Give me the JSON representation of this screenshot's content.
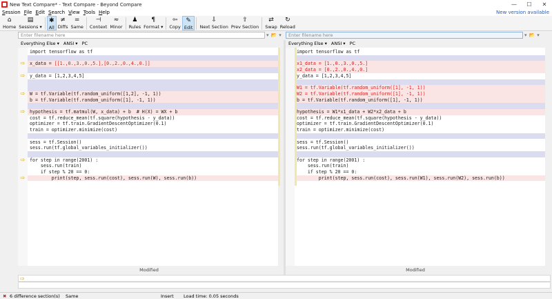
{
  "window": {
    "title": "New Text Compare* - Text Compare - Beyond Compare",
    "minimize": "—",
    "maximize": "☐",
    "close": "✕"
  },
  "menu": {
    "items": [
      "Session",
      "File",
      "Edit",
      "Search",
      "View",
      "Tools",
      "Help"
    ],
    "new_version": "New version available"
  },
  "toolbar": {
    "buttons": [
      {
        "icon": "⌂",
        "label": "Home"
      },
      {
        "icon": "▤",
        "label": "Sessions ▾"
      },
      {
        "icon": "✱",
        "label": "All"
      },
      {
        "icon": "≠",
        "label": "Diffs"
      },
      {
        "icon": "=",
        "label": "Same"
      },
      {
        "icon": "⊣",
        "label": "Context"
      },
      {
        "icon": "≈",
        "label": "Minor"
      },
      {
        "icon": "♟",
        "label": "Rules"
      },
      {
        "icon": "¶",
        "label": "Format ▾"
      },
      {
        "icon": "⇦",
        "label": "Copy"
      },
      {
        "icon": "✎",
        "label": "Edit"
      },
      {
        "icon": "⇩",
        "label": "Next Section"
      },
      {
        "icon": "⇧",
        "label": "Prev Section"
      },
      {
        "icon": "⇄",
        "label": "Swap"
      },
      {
        "icon": "↻",
        "label": "Reload"
      }
    ]
  },
  "left": {
    "path_placeholder": "Enter filename here",
    "format": "Everything Else ▾",
    "encoding": "ANSI ▾",
    "line_endings": "PC",
    "status": "Modified",
    "lines": [
      "import tensorflow as tf",
      "",
      "x_data = [[1.,0.,3.,0.,5.],[0.,2.,0.,4.,0.]]",
      "",
      "y_data = [1,2,3,4,5]",
      "",
      "",
      "W = tf.Variable(tf.random_uniform([1,2], -1, 1))",
      "b = tf.Variable(tf.random_uniform([1], -1, 1))",
      "",
      "hypothesis = tf.matmul(W, x_data) + b  # H(X) = WX + b",
      "cost = tf.reduce_mean(tf.square(hypothesis - y_data))",
      "optimizer = tf.train.GradientDescentOptimizer(0.1)",
      "train = optimizer.minimize(cost)",
      "",
      "sess = tf.Session()",
      "sess.run(tf.global_variables_initializer())",
      "",
      "for step in range(2001) :",
      "    sess.run(train)",
      "    if step % 20 == 0:",
      "        print(step, sess.run(cost), sess.run(W), sess.run(b))"
    ]
  },
  "right": {
    "path_placeholder": "Enter filename here",
    "format": "Everything Else ▾",
    "encoding": "ANSI ▾",
    "line_endings": "PC",
    "status": "Modified",
    "lines": [
      "import tensorflow as tf",
      "",
      "x1_data = [1.,0.,3.,0.,5.]",
      "x2_data = [0.,2.,0.,4.,0.]",
      "y_data = [1,2,3,4,5]",
      "",
      "W1 = tf.Variable(tf.random_uniform([1], -1, 1))",
      "W2 = tf.Variable(tf.random_uniform([1], -1, 1))",
      "b = tf.Variable(tf.random_uniform([1], -1, 1))",
      "",
      "hypothesis = W1*x1_data + W2*x2_data + b",
      "cost = tf.reduce_mean(tf.square(hypothesis - y_data))",
      "optimizer = tf.train.GradientDescentOptimizer(0.1)",
      "train = optimizer.minimize(cost)",
      "",
      "sess = tf.Session()",
      "sess.run(tf.global_variables_initializer())",
      "",
      "for step in range(2001) :",
      "    sess.run(train)",
      "    if step % 20 == 0:",
      "        print(step, sess.run(cost), sess.run(W1), sess.run(W2), sess.run(b))"
    ]
  },
  "statusbar": {
    "diff_count": "6 difference section(s)",
    "same": "Same",
    "mode": "Insert",
    "load_time": "Load time: 0.05 seconds"
  },
  "colors": {
    "diff_bg": "#fbe4e4",
    "diff_text": "#d52020",
    "marker": "#c9a415",
    "accent": "#2a5db0"
  }
}
